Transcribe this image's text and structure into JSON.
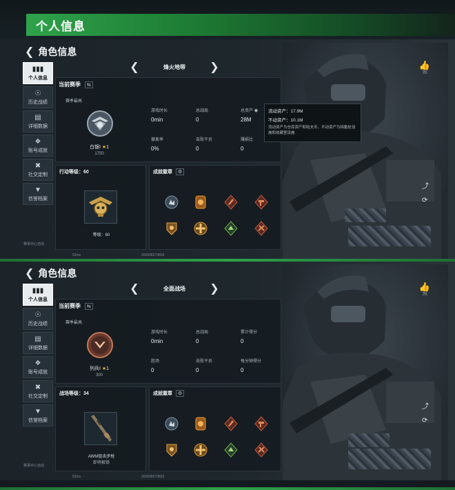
{
  "title": "个人信息",
  "header": "角色信息",
  "sidebar": [
    {
      "label": "个人信息",
      "icon": "bar-chart-icon"
    },
    {
      "label": "历史战绩",
      "icon": "history-icon"
    },
    {
      "label": "详细数据",
      "icon": "folder-icon"
    },
    {
      "label": "账号成就",
      "icon": "medal-icon"
    },
    {
      "label": "社交定制",
      "icon": "wrench-icon"
    },
    {
      "label": "信誉档案",
      "icon": "shield-icon"
    }
  ],
  "footer": {
    "service": "赛事中心自动",
    "ping": "52ms",
    "uid": "202608273835"
  },
  "likes": "70",
  "panels": [
    {
      "mode": "烽火地带",
      "season_label": "当前赛季",
      "season_swap": "⇆",
      "best_label": "赛季最高",
      "rank_name": "白银I",
      "rank_stars": "1",
      "rank_score": "1750",
      "stats": [
        {
          "k": "游戏时长",
          "v": "0min"
        },
        {
          "k": "总战局",
          "v": "0"
        },
        {
          "k": "总资产",
          "v": "28M"
        },
        {
          "k": "撤离率",
          "v": "0%"
        },
        {
          "k": "击败干员",
          "v": "0"
        },
        {
          "k": "赚损比",
          "v": "0"
        }
      ],
      "level_title": "行动等级：",
      "level_value": "60",
      "level_caption": "等级：60",
      "level_caption2": "",
      "badge_title": "成就徽章",
      "tooltip": {
        "line1_k": "流动资产：",
        "line1_v": "17.9M",
        "line2_k": "不动资产：",
        "line2_v": "10.1M",
        "note": "流动资产为仓库资产和哈夫币，不动资产为特勤处设施和收藏室设施"
      }
    },
    {
      "mode": "全面战场",
      "season_label": "当前赛季",
      "season_swap": "⇆",
      "best_label": "赛季最高",
      "rank_name": "列兵I",
      "rank_stars": "1",
      "rank_score": "300",
      "stats": [
        {
          "k": "游戏时长",
          "v": "0min"
        },
        {
          "k": "总战局",
          "v": "0"
        },
        {
          "k": "累计得分",
          "v": "0"
        },
        {
          "k": "胜场",
          "v": "0"
        },
        {
          "k": "击败干员",
          "v": "0"
        },
        {
          "k": "每分钟得分",
          "v": "0"
        }
      ],
      "level_title": "战场等级：",
      "level_value": "34",
      "level_caption": "AWM狙击步枪",
      "level_caption2": "即将解锁",
      "badge_title": "成就徽章"
    }
  ],
  "colors": {
    "accent": "#2ea24a",
    "bg": "#1b2328",
    "active_tab": "#e9ecee"
  }
}
